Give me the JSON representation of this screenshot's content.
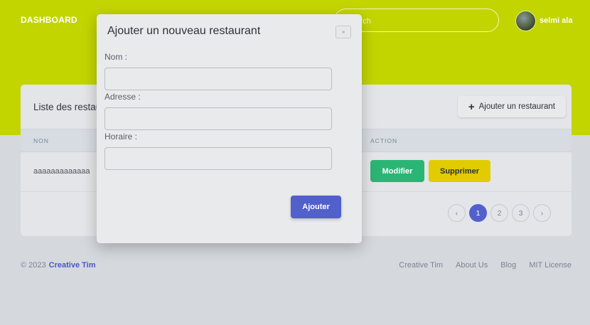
{
  "header": {
    "brand": "DASHBOARD",
    "search_placeholder": "Search",
    "user_name": "selmi ala"
  },
  "card": {
    "title": "Liste des restaurants",
    "add_button_label": "Ajouter un restaurant",
    "columns": [
      "NON",
      "ACTION"
    ],
    "rows": [
      {
        "name": "aaaaaaaaaaaaa",
        "edit_label": "Modifier",
        "delete_label": "Supprimer"
      }
    ],
    "pagination": {
      "prev": "‹",
      "pages": [
        "1",
        "2",
        "3"
      ],
      "current": "1",
      "next": "›"
    }
  },
  "footer": {
    "copyright": "© 2023",
    "brand": "Creative Tim",
    "links": [
      "Creative Tim",
      "About Us",
      "Blog",
      "MIT License"
    ]
  },
  "modal": {
    "title": "Ajouter un nouveau restaurant",
    "close_label": "×",
    "fields": [
      {
        "label": "Nom :",
        "value": ""
      },
      {
        "label": "Adresse :",
        "value": ""
      },
      {
        "label": "Horaire :",
        "value": ""
      }
    ],
    "submit_label": "Ajouter"
  },
  "colors": {
    "hero": "#c3d500",
    "primary": "#5260cc",
    "success": "#2bb575",
    "warning": "#e0cc00"
  }
}
